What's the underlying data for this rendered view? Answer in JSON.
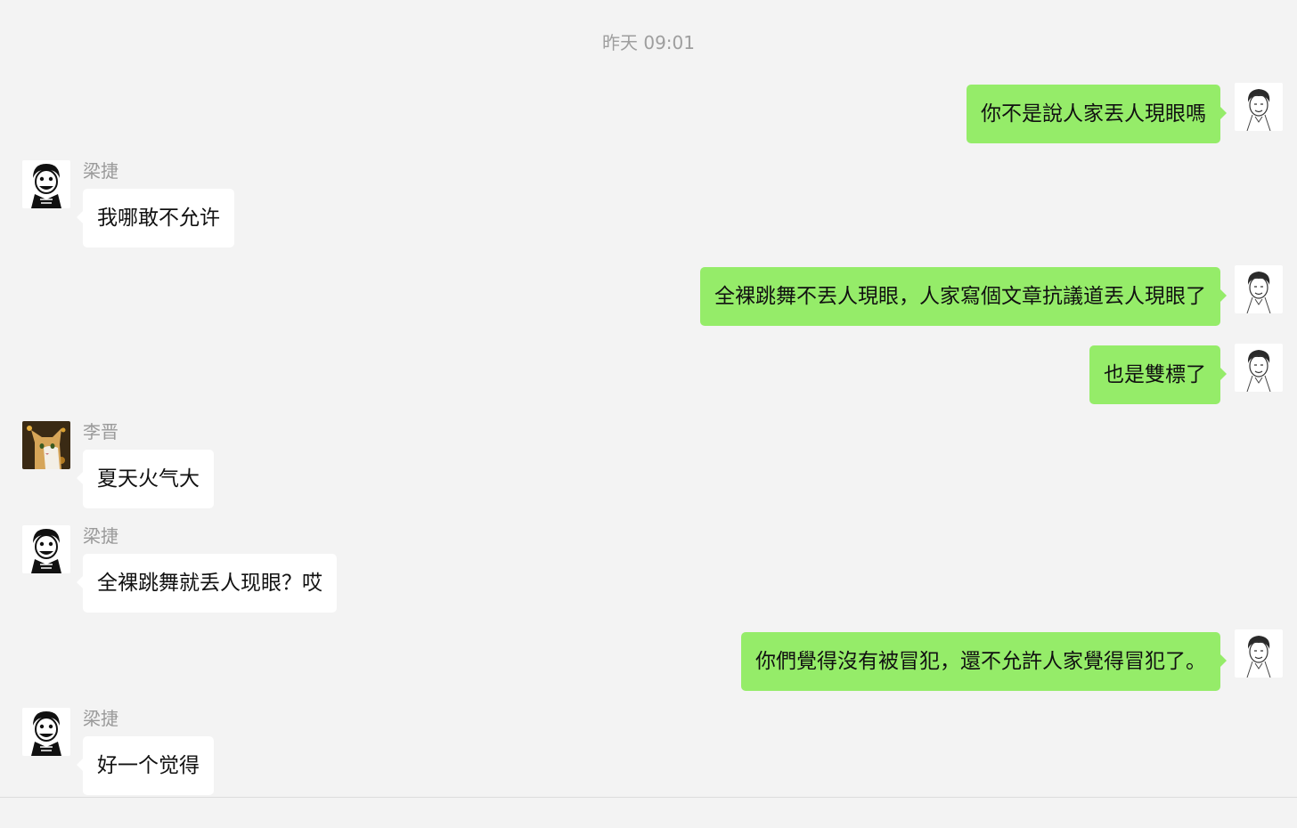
{
  "chat": {
    "timestamp": "昨天 09:01",
    "messages": [
      {
        "direction": "out",
        "sender": "",
        "text": "你不是說人家丟人現眼嗎",
        "avatar": "sketch-portrait-avatar"
      },
      {
        "direction": "in",
        "sender": "梁捷",
        "text": "我哪敢不允许",
        "avatar": "cartoon-man-avatar"
      },
      {
        "direction": "out",
        "sender": "",
        "text": "全裸跳舞不丟人現眼，人家寫個文章抗議道丟人現眼了",
        "avatar": "sketch-portrait-avatar"
      },
      {
        "direction": "out",
        "sender": "",
        "text": "也是雙標了",
        "avatar": "sketch-portrait-avatar"
      },
      {
        "direction": "in",
        "sender": "李晋",
        "text": "夏天火气大",
        "avatar": "cat-photo-avatar"
      },
      {
        "direction": "in",
        "sender": "梁捷",
        "text": "全裸跳舞就丢人现眼？哎",
        "avatar": "cartoon-man-avatar"
      },
      {
        "direction": "out",
        "sender": "",
        "text": "你們覺得沒有被冒犯，還不允許人家覺得冒犯了。",
        "avatar": "sketch-portrait-avatar"
      },
      {
        "direction": "in",
        "sender": "梁捷",
        "text": "好一个觉得",
        "avatar": "cartoon-man-avatar"
      }
    ]
  },
  "colors": {
    "background": "#f3f3f3",
    "outgoing_bubble": "#95ec69",
    "incoming_bubble": "#ffffff",
    "timestamp_text": "#9e9e9e",
    "sender_text": "#9a9a9a"
  }
}
